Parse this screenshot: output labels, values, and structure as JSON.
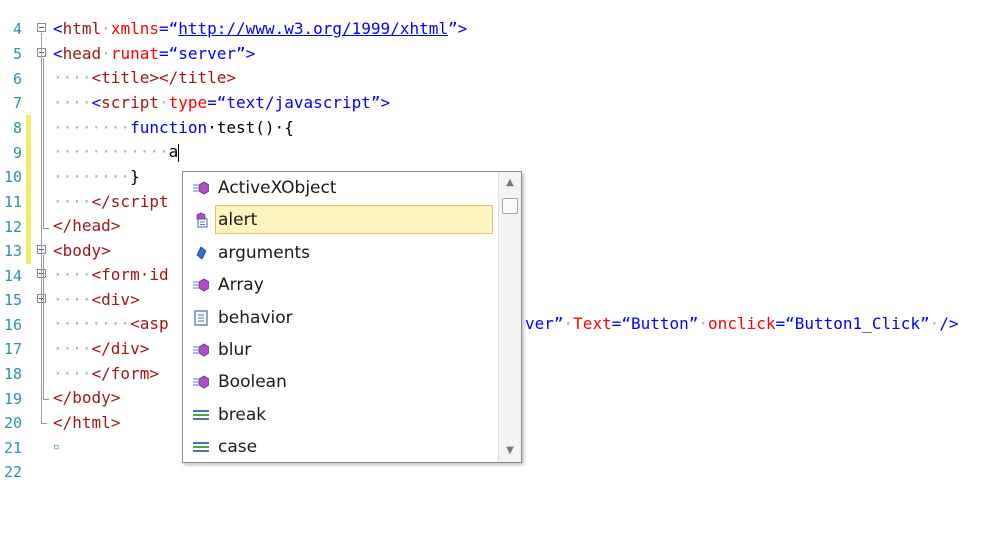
{
  "editor": {
    "lines": [
      {
        "num": "4"
      },
      {
        "num": "5",
        "tag_open": "<",
        "tag": "html",
        "attr": "xmlns",
        "eq": "=“",
        "url": "http://www.w3.org/1999/xhtml",
        "close": "”>"
      },
      {
        "num": "6",
        "tag_open": "<",
        "tag": "head",
        "attr": "runat",
        "eq": "=“",
        "val": "server",
        "close": "”>"
      },
      {
        "num": "7",
        "dots": "····",
        "text": "<title></title>"
      },
      {
        "num": "8",
        "dots": "····",
        "tag_open": "<",
        "tag": "script",
        "attr": "type",
        "eq": "=“",
        "val": "text/javascript",
        "close": "”>"
      },
      {
        "num": "9",
        "dots": "········",
        "kw": "function",
        "rest": "·test()·{"
      },
      {
        "num": "10",
        "dots": "············",
        "typed": "a"
      },
      {
        "num": "11",
        "dots": "········",
        "text": "}"
      },
      {
        "num": "12",
        "dots": "····",
        "text": "</script"
      },
      {
        "num": "13",
        "text": "</head>"
      },
      {
        "num": "14",
        "text": "<body>"
      },
      {
        "num": "15",
        "dots": "····",
        "text": "<form·id"
      },
      {
        "num": "16",
        "dots": "····",
        "text": "<div>"
      },
      {
        "num": "17",
        "dots": "········",
        "text": "<asp",
        "tail_val_end": "ver”",
        "attr2": "Text",
        "val2": "Button",
        "attr3": "onclick",
        "val3": "Button1_Click",
        "end": "/>"
      },
      {
        "num": "18",
        "dots": "····",
        "text": "</div>"
      },
      {
        "num": "19",
        "dots": "····",
        "text": "</form>"
      },
      {
        "num": "20",
        "text": "</body>"
      },
      {
        "num": "21",
        "text": "</html>"
      },
      {
        "num": "22",
        "text": "▫"
      }
    ]
  },
  "intellisense": {
    "items": [
      {
        "label": "ActiveXObject",
        "icon": "object-icon"
      },
      {
        "label": "alert",
        "icon": "method-doc-icon",
        "selected": true
      },
      {
        "label": "arguments",
        "icon": "variable-icon"
      },
      {
        "label": "Array",
        "icon": "object-icon"
      },
      {
        "label": "behavior",
        "icon": "document-icon"
      },
      {
        "label": "blur",
        "icon": "object-icon"
      },
      {
        "label": "Boolean",
        "icon": "object-icon"
      },
      {
        "label": "break",
        "icon": "keyword-icon"
      },
      {
        "label": "case",
        "icon": "keyword-icon"
      }
    ]
  },
  "colors": {
    "tag": "#a31515",
    "attr": "#ff0000",
    "string": "#0000ff",
    "line_number": "#2b91af",
    "selection_bg": "#fdf4bf",
    "modified_bar": "#f2ec6a"
  }
}
